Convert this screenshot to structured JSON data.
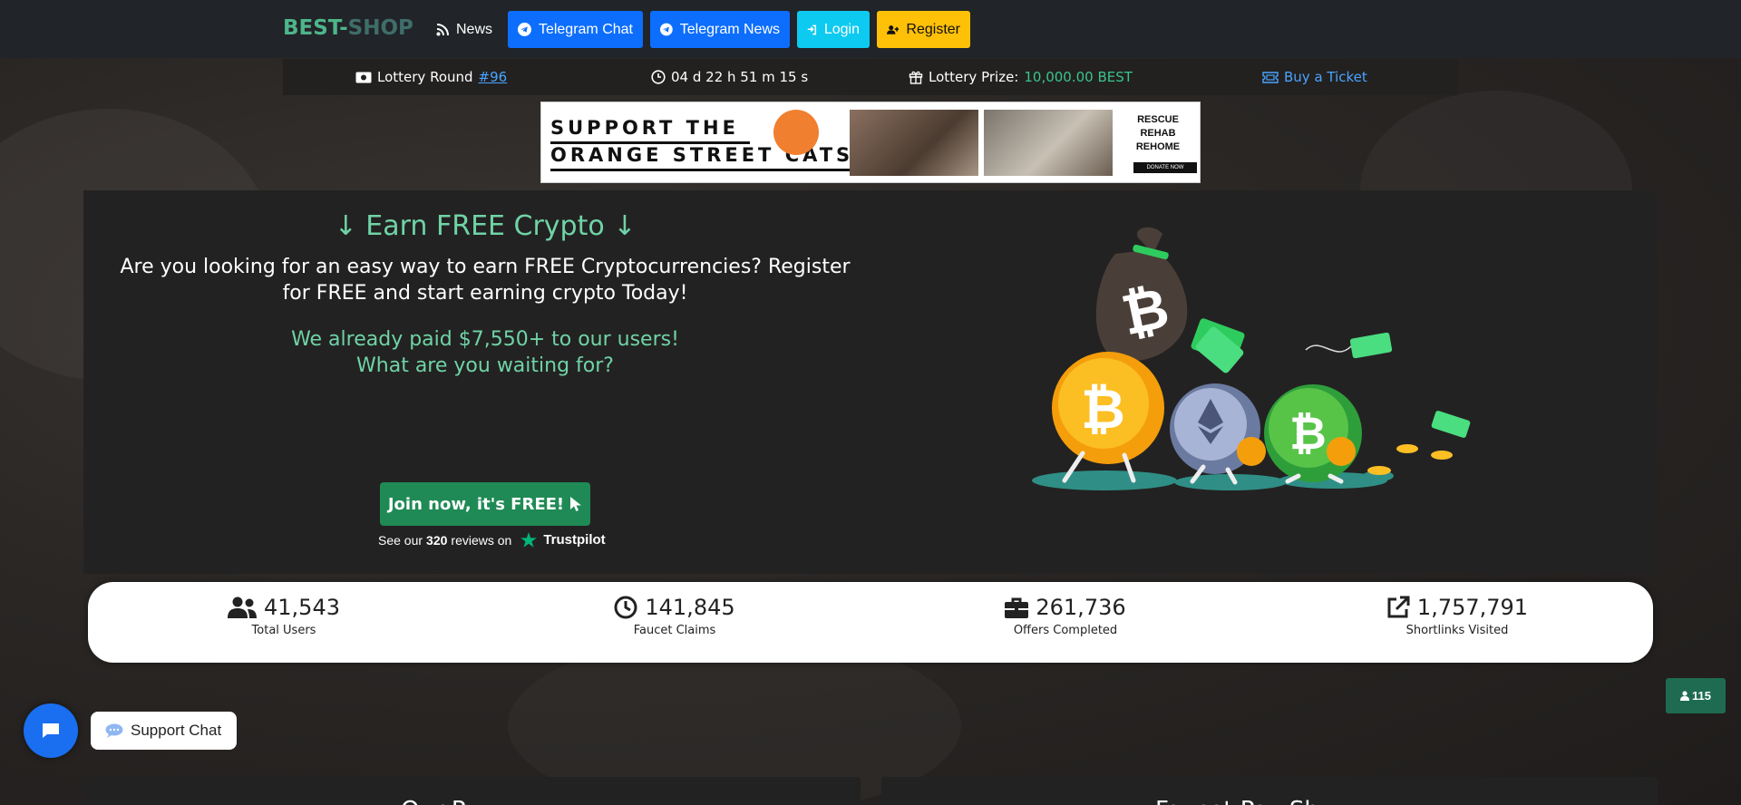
{
  "navbar": {
    "logo_main": "BEST-",
    "logo_dim": "SHOP",
    "items": [
      {
        "label": "News",
        "icon": "rss-icon"
      },
      {
        "label": "Telegram Chat",
        "icon": "telegram-icon"
      },
      {
        "label": "Telegram News",
        "icon": "telegram-icon"
      },
      {
        "label": "Login",
        "icon": "sign-in-icon"
      },
      {
        "label": "Register",
        "icon": "user-plus-icon"
      }
    ]
  },
  "lottery": {
    "round_label": "Lottery Round",
    "round_number": "#96",
    "timer": "04 d 22 h 51 m 15 s",
    "prize_label": "Lottery Prize:",
    "prize_value": "10,000.00 BEST",
    "buy_label": "Buy a Ticket"
  },
  "banner": {
    "line1": "SUPPORT THE",
    "line2": "ORANGE STREET CATS",
    "rescue": [
      "RESCUE",
      "REHAB",
      "REHOME"
    ],
    "donate": "DONATE NOW"
  },
  "hero": {
    "title": "Earn FREE Crypto",
    "subtitle": "Are you looking for an easy way to earn FREE Cryptocurrencies? Register for FREE and start earning crypto Today!",
    "paid_line1": "We already paid $7,550+ to our users!",
    "paid_line2": "What are you waiting for?",
    "join_label": "Join now, it's FREE!",
    "trustpilot_prefix": "See our",
    "trustpilot_count": "320",
    "trustpilot_suffix": "reviews on",
    "trustpilot_brand": "Trustpilot"
  },
  "stats": [
    {
      "value": "41,543",
      "label": "Total Users",
      "icon": "users-icon"
    },
    {
      "value": "141,845",
      "label": "Faucet Claims",
      "icon": "clock-icon"
    },
    {
      "value": "261,736",
      "label": "Offers Completed",
      "icon": "briefcase-icon"
    },
    {
      "value": "1,757,791",
      "label": "Shortlinks Visited",
      "icon": "external-link-icon"
    }
  ],
  "online": {
    "count": "115"
  },
  "support": {
    "label": "Support Chat"
  },
  "bottom": {
    "card1_title": "Our P",
    "card2_title": "Faucet Pay Sh"
  },
  "colors": {
    "accent_green": "#6fd3a6",
    "primary_blue": "#0d6efd",
    "info_cyan": "#0dcaf0",
    "warning_yellow": "#ffc107"
  }
}
